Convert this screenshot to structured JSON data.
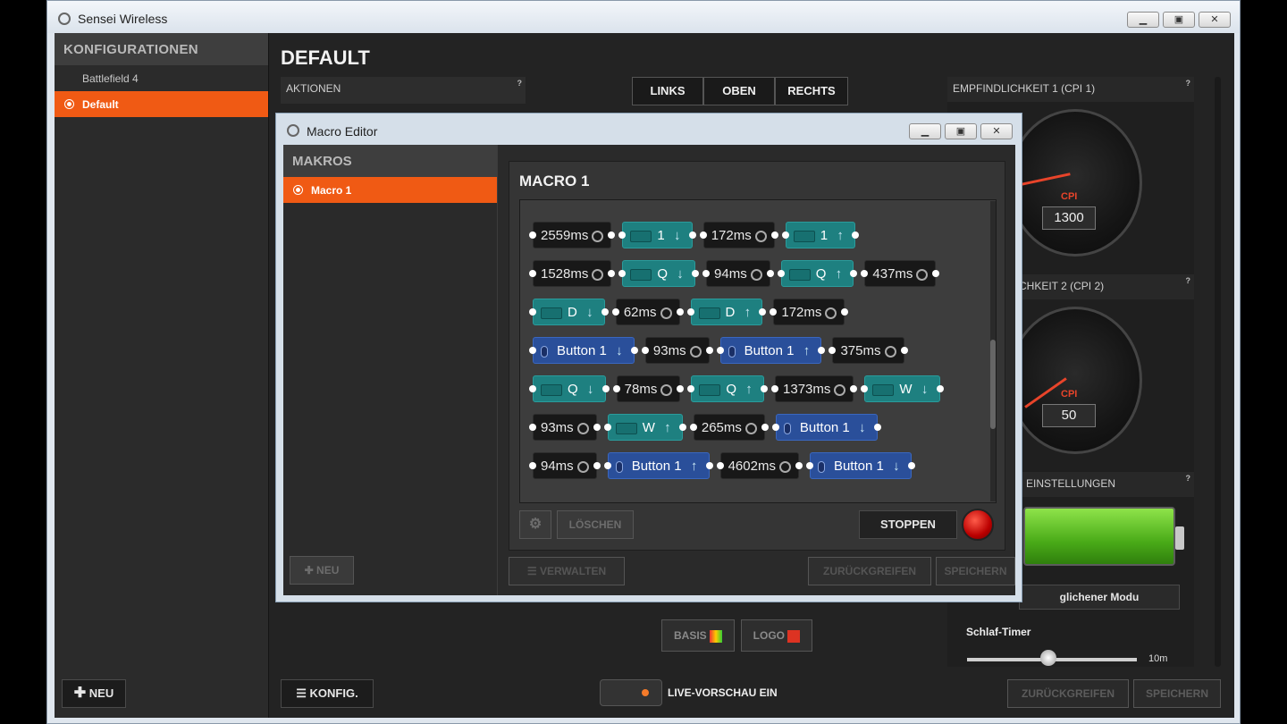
{
  "window": {
    "title": "Sensei Wireless"
  },
  "sidebar": {
    "header": "KONFIGURATIONEN",
    "items": [
      {
        "label": "Battlefield 4",
        "active": false
      },
      {
        "label": "Default",
        "active": true
      }
    ],
    "new_label": "NEU"
  },
  "main": {
    "title": "DEFAULT",
    "actions_label": "AKTIONEN",
    "tabs": [
      "LINKS",
      "OBEN",
      "RECHTS"
    ],
    "basis_label": "BASIS",
    "logo_label": "LOGO",
    "konfig_label": "KONFIG.",
    "live_label": "LIVE-VORSCHAU EIN",
    "revert_label": "ZURÜCKGREIFEN",
    "save_label": "SPEICHERN"
  },
  "sensitivity": {
    "cpi1_label": "EMPFINDLICHKEIT 1 (CPI 1)",
    "cpi1_value": "1300",
    "cpi2_label": "CHKEIT 2 (CPI 2)",
    "cpi2_value": "50",
    "gauge_label": "CPI"
  },
  "power": {
    "settings_label": "EINSTELLUNGEN",
    "mode_label": "glichener Modu",
    "sleep_label": "Schlaf-Timer",
    "sleep_value": "10m"
  },
  "macro_editor": {
    "title": "Macro Editor",
    "list_header": "MAKROS",
    "items": [
      {
        "label": "Macro 1",
        "active": true
      }
    ],
    "new_label": "NEU",
    "macro_title": "MACRO 1",
    "delete_label": "LÖSCHEN",
    "stop_label": "STOPPEN",
    "manage_label": "VERWALTEN",
    "revert_label": "ZURÜCKGREIFEN",
    "save_label": "SPEICHERN",
    "rows": [
      [
        "2559ms",
        "1 ↓",
        "172ms",
        "1 ↑"
      ],
      [
        "1528ms",
        "Q ↓",
        "94ms",
        "Q ↑",
        "437ms"
      ],
      [
        "D ↓",
        "62ms",
        "D ↑",
        "172ms"
      ],
      [
        "Button 1 ↓",
        "93ms",
        "Button 1 ↑",
        "375ms"
      ],
      [
        "Q ↓",
        "78ms",
        "Q ↑",
        "1373ms",
        "W ↓"
      ],
      [
        "93ms",
        "W ↑",
        "265ms",
        "Button 1 ↓"
      ],
      [
        "94ms",
        "Button 1 ↑",
        "4602ms",
        "Button 1 ↓"
      ]
    ]
  },
  "colors": {
    "accent": "#f05a14",
    "key_block": "#1e8080",
    "mouse_block": "#2a4f9a",
    "delay_block": "#181818"
  }
}
